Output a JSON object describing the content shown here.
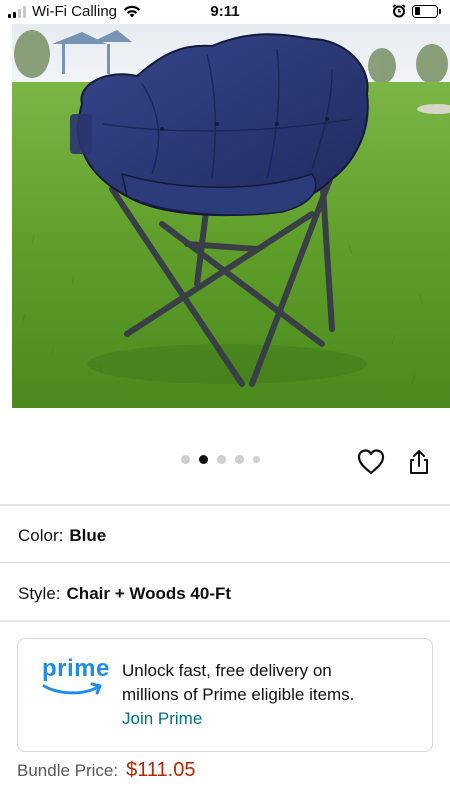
{
  "status_bar": {
    "carrier": "Wi-Fi Calling",
    "time": "9:11",
    "battery_level": 0.25
  },
  "product": {
    "image_alt": "Blue padded folding chair on grass",
    "carousel": {
      "count": 5,
      "active_index": 1
    }
  },
  "icons": {
    "wishlist": "heart-icon",
    "share": "share-icon"
  },
  "variations": {
    "color_label": "Color:",
    "color_value": "Blue",
    "style_label": "Style:",
    "style_value": "Chair + Woods 40-Ft"
  },
  "prime": {
    "logo_text": "prime",
    "message_line1": "Unlock fast, free delivery on",
    "message_line2": "millions of Prime eligible items.",
    "join_link": "Join Prime",
    "brand_color": "#1f8ce6"
  },
  "bundle": {
    "label": "Bundle Price:",
    "price": "$111.05"
  }
}
